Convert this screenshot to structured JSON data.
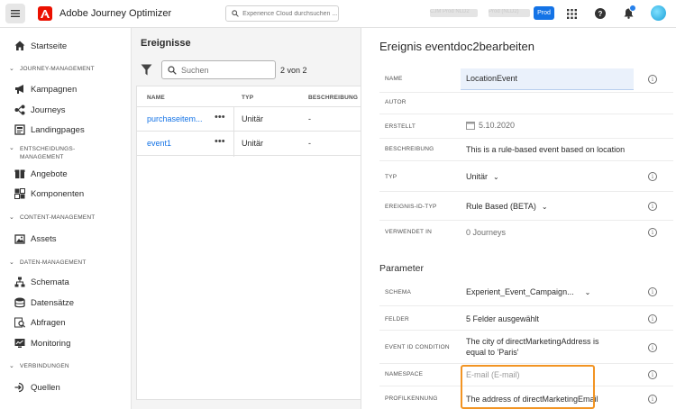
{
  "topbar": {
    "app_title": "Adobe Journey Optimizer",
    "search_placeholder": "Experience Cloud durchsuchen ...",
    "org_a": "CJM Prod NLD2",
    "org_b": "Prod (NLD2)",
    "env_badge": "Prod",
    "brand_color": "#eb1000",
    "badge_color": "#1473e6"
  },
  "sidebar": {
    "home": "Startseite",
    "sections": [
      {
        "label": "JOURNEY-MANAGEMENT",
        "items": [
          "Kampagnen",
          "Journeys",
          "Landingpages"
        ]
      },
      {
        "label": "ENTSCHEIDUNGS-",
        "label2": "MANAGEMENT",
        "items": [
          "Angebote",
          "Komponenten"
        ]
      },
      {
        "label": "CONTENT-MANAGEMENT",
        "items": [
          "Assets"
        ]
      },
      {
        "label": "DATEN-MANAGEMENT",
        "items": [
          "Schemata",
          "Datensätze",
          "Abfragen",
          "Monitoring"
        ]
      },
      {
        "label": "VERBINDUNGEN",
        "items": [
          "Quellen"
        ]
      }
    ]
  },
  "list": {
    "title": "Ereignisse",
    "search_placeholder": "Suchen",
    "count": "2 von 2",
    "columns": [
      "NAME",
      "TYP",
      "BESCHREIBUNG"
    ],
    "rows": [
      {
        "name": "purchaseitem...",
        "more": "•••",
        "type": "Unitär",
        "description": "-"
      },
      {
        "name": "event1",
        "more": "•••",
        "type": "Unitär",
        "description": "-"
      }
    ]
  },
  "detail": {
    "title": "Ereignis eventdoc2bearbeiten",
    "fields": {
      "name_label": "NAME",
      "name_value": "LocationEvent",
      "author_label": "AUTOR",
      "created_label": "ERSTELLT",
      "created_value": "5.10.2020",
      "description_label": "BESCHREIBUNG",
      "description_value": "This is a rule-based event based on location",
      "type_label": "TYP",
      "type_value": "Unitär",
      "event_id_type_label": "EREIGNIS-ID-TYP",
      "event_id_type_value": "Rule Based (BETA)",
      "used_in_label": "VERWENDET IN",
      "used_in_value": "0 Journeys"
    },
    "parameters": {
      "title": "Parameter",
      "schema_label": "SCHEMA",
      "schema_value": "Experient_Event_Campaign...",
      "fields_label": "FELDER",
      "fields_value": "5 Felder ausgewählt",
      "condition_label": "EVENT ID CONDITION",
      "condition_line1": "The city of directMarketingAddress is",
      "condition_line2": "equal to 'Paris'",
      "namespace_label": "NAMESPACE",
      "namespace_placeholder": "E-mail (E-mail)",
      "profile_id_label": "PROFILKENNUNG",
      "profile_id_value": "The address of directMarketingEmail"
    },
    "highlight_color": "#f29423"
  }
}
